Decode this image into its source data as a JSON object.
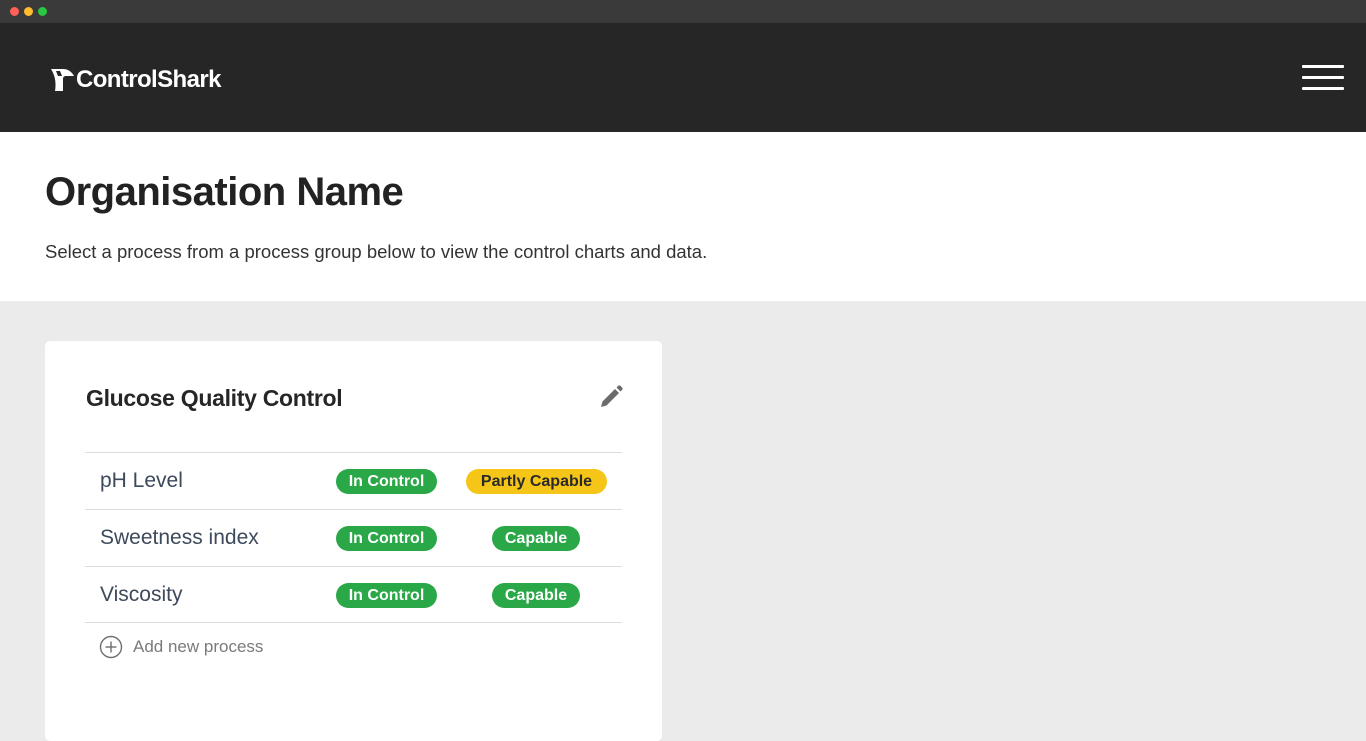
{
  "window": {
    "controls": [
      "close",
      "minimize",
      "maximize"
    ]
  },
  "header": {
    "brand": "ControlShark",
    "logo_icon": "shark-fin-logo-icon",
    "menu_icon": "hamburger-menu-icon"
  },
  "intro": {
    "title": "Organisation Name",
    "subtitle": "Select a process from a process group below to view the control charts and data."
  },
  "group": {
    "title": "Glucose Quality Control",
    "edit_icon": "pencil-icon",
    "processes": [
      {
        "name": "pH Level",
        "control_status": "In Control",
        "capability_status": "Partly Capable"
      },
      {
        "name": "Sweetness index",
        "control_status": "In Control",
        "capability_status": "Capable"
      },
      {
        "name": "Viscosity",
        "control_status": "In Control",
        "capability_status": "Capable"
      }
    ],
    "add_label": "Add new process",
    "add_icon": "plus-circle-icon"
  },
  "colors": {
    "header_bg": "#262626",
    "in_control": "#2aa847",
    "capable": "#2aa847",
    "partly_capable": "#f5c518",
    "page_bg": "#ebebeb"
  }
}
